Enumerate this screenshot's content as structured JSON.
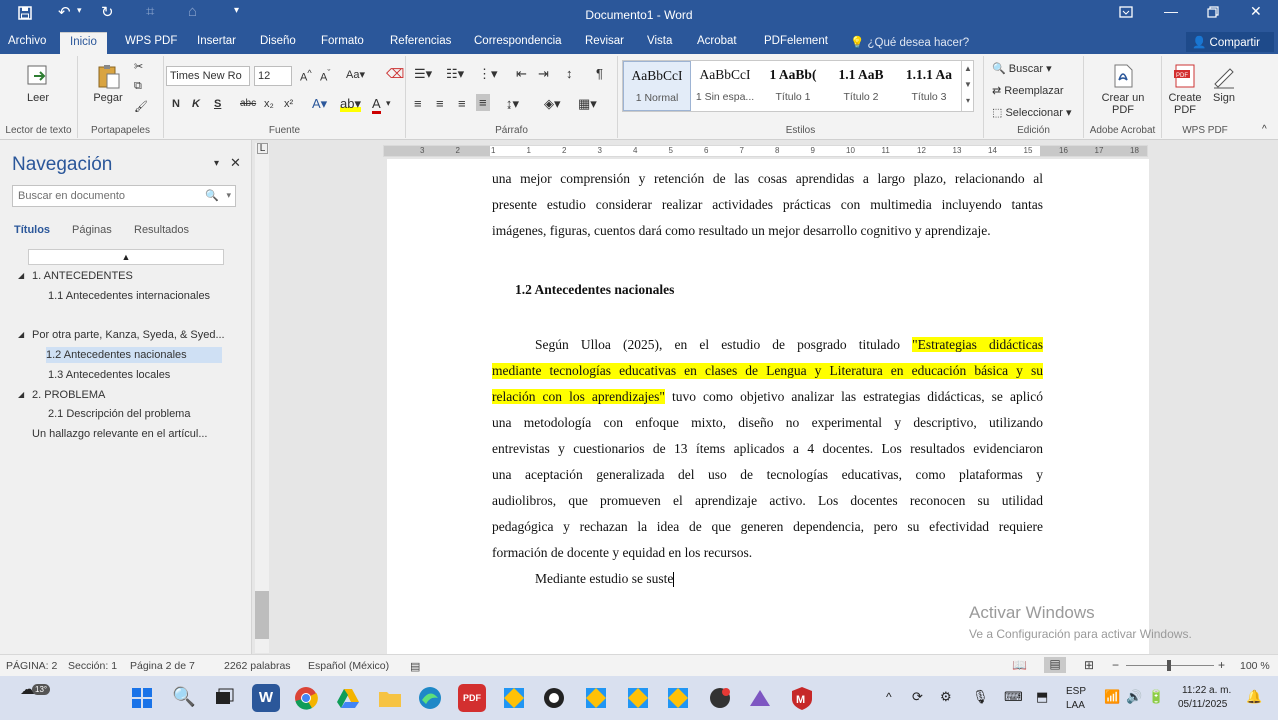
{
  "window": {
    "title": "Documento1 - Word"
  },
  "menu": {
    "tabs": [
      "Archivo",
      "Inicio",
      "WPS PDF",
      "Insertar",
      "Diseño",
      "Formato",
      "Referencias",
      "Correspondencia",
      "Revisar",
      "Vista",
      "Acrobat",
      "PDFelement"
    ],
    "tell_me": "¿Qué desea hacer?",
    "share": "Compartir"
  },
  "ribbon": {
    "read": "Leer",
    "paste": "Pegar",
    "font_name": "Times New Ro",
    "font_size": "12",
    "bold": "N",
    "italic": "K",
    "underline": "S",
    "strike": "abc",
    "sub": "x₂",
    "sup": "x²",
    "styles": [
      {
        "preview": "AaBbCcI",
        "name": "1 Normal"
      },
      {
        "preview": "AaBbCcI",
        "name": "1 Sin espa..."
      },
      {
        "preview": "1 AaBb(",
        "name": "Título 1"
      },
      {
        "preview": "1.1 AaB",
        "name": "Título 2"
      },
      {
        "preview": "1.1.1 Aa",
        "name": "Título 3"
      }
    ],
    "find": "Buscar",
    "replace": "Reemplazar",
    "select": "Seleccionar",
    "create_pdf": "Crear un PDF",
    "create_pdf2": "Create PDF",
    "sign": "Sign",
    "groups": [
      "Lector de texto",
      "Portapapeles",
      "Fuente",
      "Párrafo",
      "Estilos",
      "Edición",
      "Adobe Acrobat",
      "WPS PDF"
    ]
  },
  "nav": {
    "title": "Navegación",
    "search_placeholder": "Buscar en documento",
    "tabs": [
      "Títulos",
      "Páginas",
      "Resultados"
    ],
    "items": [
      "1. ANTECEDENTES",
      "1.1 Antecedentes internacionales",
      "Por otra parte, Kanza, Syeda, & Syed...",
      "1.2 Antecedentes nacionales",
      "1.3 Antecedentes locales",
      "2. PROBLEMA",
      "2.1 Descripción del problema",
      "Un hallazgo relevante en el artícul..."
    ]
  },
  "ruler": {
    "numbers": [
      "3",
      "2",
      "1",
      "1",
      "2",
      "3",
      "4",
      "5",
      "6",
      "7",
      "8",
      "9",
      "10",
      "11",
      "12",
      "13",
      "14",
      "15",
      "16",
      "17",
      "18"
    ]
  },
  "document": {
    "p1": [
      "una mejor comprensión y retención de las cosas aprendidas a largo plazo, relacionando al",
      "presente estudio considerar realizar actividades prácticas con multimedia incluyendo tantas",
      "imágenes, figuras, cuentos dará como resultado un mejor desarrollo cognitivo y aprendizaje."
    ],
    "heading": "1.2 Antecedentes nacionales",
    "p2_l1_a": "Según Ulloa (2025), en el estudio de posgrado titulado ",
    "p2_l1_b": "\"Estrategias didácticas",
    "p2_l2": "mediante tecnologías educativas en clases de Lengua y Literatura en educación básica y su",
    "p2_l3_a": "relación con los aprendizajes\"",
    "p2_l3_b": " tuvo como objetivo analizar las estrategias didácticas, se aplicó",
    "p2_rest": [
      "una metodología con enfoque mixto, diseño no experimental y descriptivo, utilizando",
      "entrevistas y cuestionarios de 13 ítems aplicados a 4 docentes. Los resultados evidenciaron",
      "una aceptación generalizada del uso de tecnologías educativas, como plataformas y",
      "audiolibros, que promueven el aprendizaje activo. Los docentes reconocen su utilidad",
      "pedagógica y rechazan la idea de que generen dependencia, pero su efectividad requiere",
      "formación de docente y equidad en los recursos."
    ],
    "p3": "Mediante estudio se suste"
  },
  "watermark": {
    "line1": "Activar Windows",
    "line2": "Ve a Configuración para activar Windows."
  },
  "status": {
    "page": "PÁGINA: 2",
    "section": "Sección: 1",
    "pages": "Página 2 de 7",
    "words": "2262 palabras",
    "lang": "Español (México)",
    "zoom": "100 %"
  },
  "taskbar": {
    "weather": "13°",
    "lang1": "ESP",
    "lang2": "LAA",
    "time": "11:22 a. m.",
    "date": "05/11/2025"
  }
}
